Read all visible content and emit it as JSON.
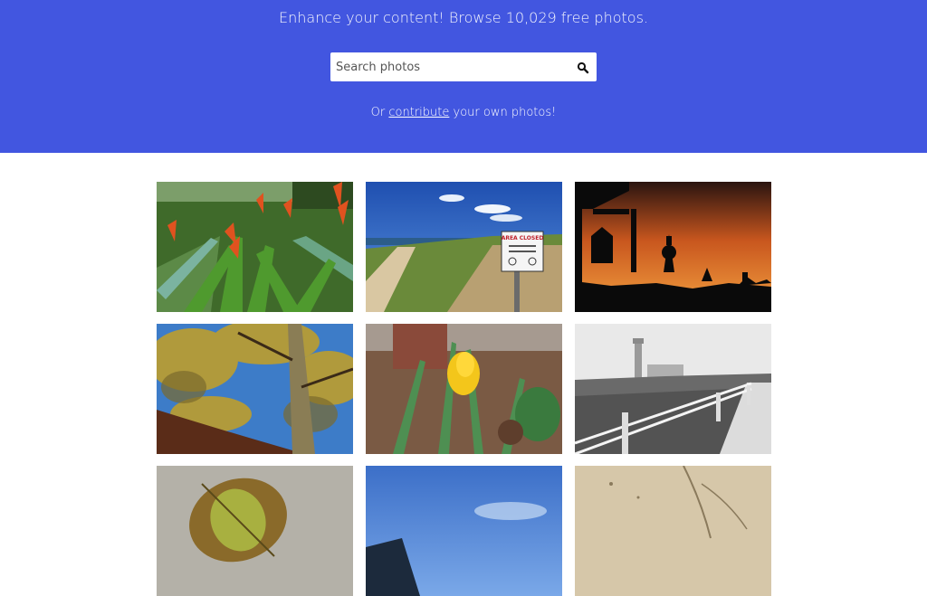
{
  "hero": {
    "tagline": "Enhance your content! Browse 10,029 free photos.",
    "search_placeholder": "Search photos",
    "contrib_prefix": "Or ",
    "contrib_link": "contribute",
    "contrib_suffix": " your own photos!",
    "background_color": "#4256e0"
  },
  "photos": [
    {
      "subject": "red heliconia flowers garden",
      "sign_text": ""
    },
    {
      "subject": "beach dune path with sign",
      "sign_text": "AREA CLOSED"
    },
    {
      "subject": "temple silhouette at sunset",
      "sign_text": ""
    },
    {
      "subject": "tree branches blue sky",
      "sign_text": ""
    },
    {
      "subject": "yellow daffodil",
      "sign_text": ""
    },
    {
      "subject": "black and white lighthouse fence",
      "sign_text": ""
    },
    {
      "subject": "autumn leaf on stone",
      "sign_text": ""
    },
    {
      "subject": "blue sky",
      "sign_text": ""
    },
    {
      "subject": "sand ripples",
      "sign_text": ""
    }
  ]
}
